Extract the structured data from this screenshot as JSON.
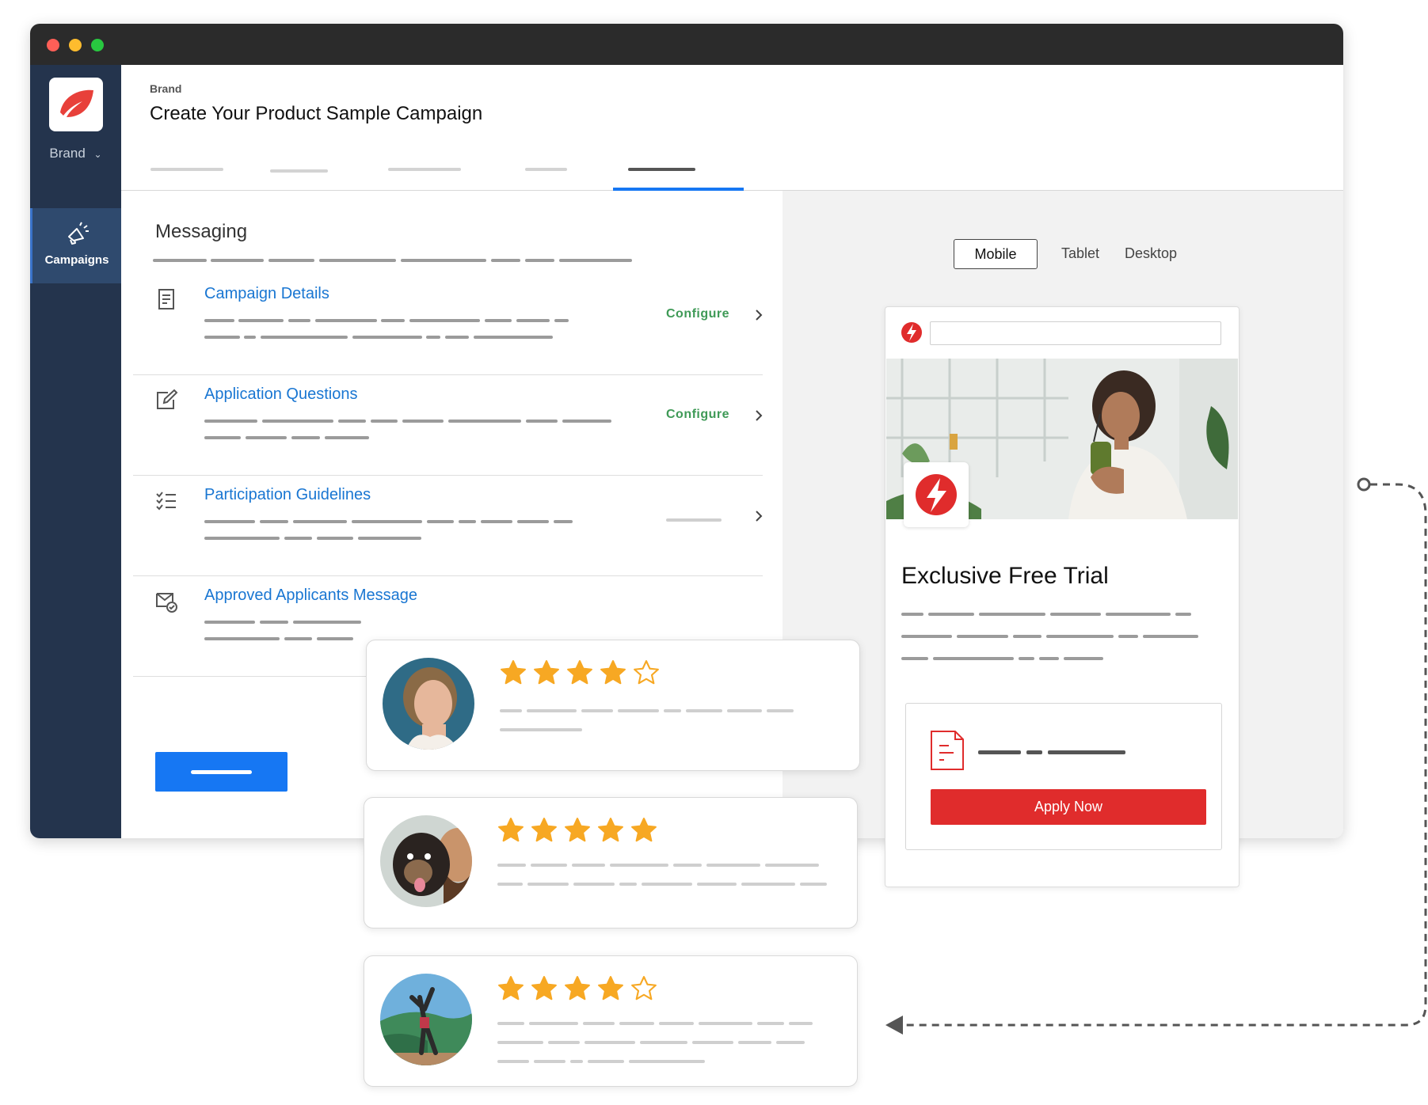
{
  "sidebar": {
    "brand_select": "Brand",
    "nav": [
      {
        "label": "Campaigns",
        "icon": "megaphone-icon"
      }
    ]
  },
  "header": {
    "breadcrumb": "Brand",
    "title": "Create Your Product Sample Campaign"
  },
  "messaging": {
    "title": "Messaging",
    "rows": [
      {
        "title": "Campaign Details",
        "icon": "document-icon",
        "action": "Configure"
      },
      {
        "title": "Application Questions",
        "icon": "edit-icon",
        "action": "Configure"
      },
      {
        "title": "Participation Guidelines",
        "icon": "checklist-icon",
        "action": ""
      },
      {
        "title": "Approved Applicants Message",
        "icon": "mail-check-icon",
        "action": ""
      }
    ]
  },
  "device_toggle": {
    "options": [
      "Mobile",
      "Tablet",
      "Desktop"
    ],
    "selected": "Mobile"
  },
  "preview": {
    "headline": "Exclusive Free Trial",
    "apply_label": "Apply Now"
  },
  "reviews": [
    {
      "rating": 4,
      "max": 5
    },
    {
      "rating": 5,
      "max": 5
    },
    {
      "rating": 4,
      "max": 5
    }
  ],
  "colors": {
    "sidebar": "#24344d",
    "link_blue": "#1976d2",
    "configure_green": "#3f9a57",
    "brand_red": "#e02c2c",
    "star": "#f7a823",
    "primary_button": "#1677f3"
  }
}
